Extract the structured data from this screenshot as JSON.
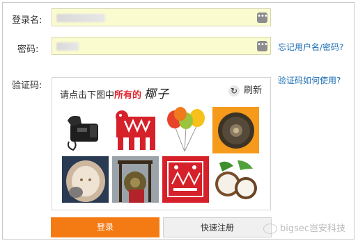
{
  "form": {
    "username_label": "登录名:",
    "password_label": "密码:",
    "captcha_label": "验证码:"
  },
  "links": {
    "forgot": "忘记用户名/密码?",
    "captcha_help": "验证码如何使用?"
  },
  "captcha": {
    "prompt_prefix": "请点击下图中",
    "prompt_emphasis": "所有的",
    "prompt_target": "椰子",
    "refresh_label": "刷新",
    "tiles": [
      {
        "name": "telephone"
      },
      {
        "name": "paper-cut-tiger"
      },
      {
        "name": "balloons"
      },
      {
        "name": "gong"
      },
      {
        "name": "coconut-bowl"
      },
      {
        "name": "gong-on-stand"
      },
      {
        "name": "paper-cut-red"
      },
      {
        "name": "coconut-halves"
      }
    ]
  },
  "buttons": {
    "login": "登录",
    "register": "快速注册"
  },
  "watermark": "bigsec岂安科技",
  "colors": {
    "input_bg": "#fbfbd0",
    "link": "#1a6db3",
    "login_bg": "#f47b14",
    "highlight": "#e0252b"
  }
}
